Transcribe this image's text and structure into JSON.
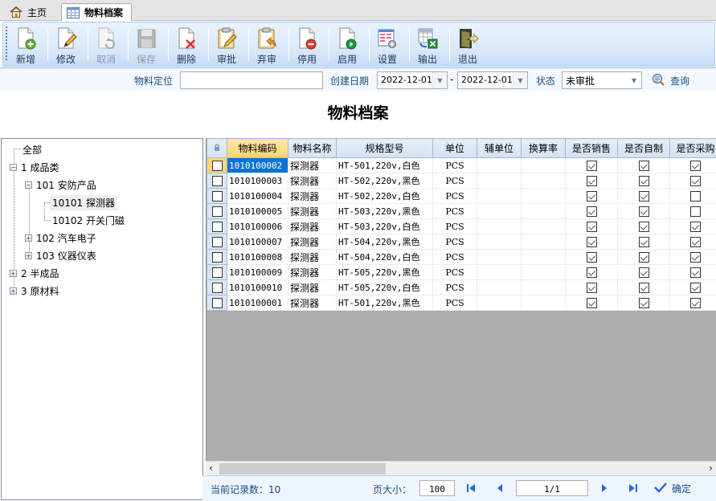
{
  "tabs": [
    {
      "label": "主页",
      "icon": "home-icon",
      "active": false
    },
    {
      "label": "物料档案",
      "icon": "table-icon",
      "active": true
    }
  ],
  "toolbar": {
    "buttons": [
      {
        "id": "add",
        "label": "新增",
        "icon": "new-document-icon",
        "enabled": true
      },
      {
        "id": "edit",
        "label": "修改",
        "icon": "edit-document-icon",
        "enabled": true
      },
      {
        "id": "cancel",
        "label": "取消",
        "icon": "undo-document-icon",
        "enabled": false
      },
      {
        "id": "save",
        "label": "保存",
        "icon": "save-floppy-icon",
        "enabled": false
      },
      {
        "id": "delete",
        "label": "删除",
        "icon": "delete-document-icon",
        "enabled": true
      },
      {
        "id": "approve",
        "label": "审批",
        "icon": "approve-clipboard-icon",
        "enabled": true
      },
      {
        "id": "unapprove",
        "label": "弃审",
        "icon": "unapprove-clipboard-icon",
        "enabled": true
      },
      {
        "id": "disable",
        "label": "停用",
        "icon": "stop-document-icon",
        "enabled": true
      },
      {
        "id": "enable",
        "label": "启用",
        "icon": "play-document-icon",
        "enabled": true
      },
      {
        "id": "settings",
        "label": "设置",
        "icon": "settings-grid-icon",
        "enabled": true
      },
      {
        "id": "export",
        "label": "输出",
        "icon": "export-excel-icon",
        "enabled": true
      },
      {
        "id": "exit",
        "label": "退出",
        "icon": "exit-door-icon",
        "enabled": true
      }
    ]
  },
  "filter": {
    "locate_label": "物料定位",
    "locate_value": "",
    "date_label": "创建日期",
    "date_from": "2022-12-01",
    "date_sep": "-",
    "date_to": "2022-12-01",
    "status_label": "状态",
    "status_value": "未审批",
    "search_label": "查询"
  },
  "page_title": "物料档案",
  "tree": [
    {
      "label": "全部",
      "level": 0,
      "expander": null
    },
    {
      "label": "1  成品类",
      "level": 0,
      "expander": "minus"
    },
    {
      "label": "101  安防产品",
      "level": 1,
      "expander": "minus"
    },
    {
      "label": "10101  探测器",
      "level": 2,
      "expander": null,
      "selected": true
    },
    {
      "label": "10102  开关门磁",
      "level": 2,
      "expander": null
    },
    {
      "label": "102  汽车电子",
      "level": 1,
      "expander": "plus"
    },
    {
      "label": "103  仪器仪表",
      "level": 1,
      "expander": "plus"
    },
    {
      "label": "2  半成品",
      "level": 0,
      "expander": "plus"
    },
    {
      "label": "3  原材料",
      "level": 0,
      "expander": "plus"
    }
  ],
  "grid": {
    "columns": [
      "物料编码",
      "物料名称",
      "规格型号",
      "单位",
      "辅单位",
      "换算率",
      "是否销售",
      "是否自制",
      "是否采购"
    ],
    "rows": [
      {
        "code": "1010100002",
        "name": "探测器",
        "spec": "HT-501,220v,白色",
        "unit": "PCS",
        "aux_unit": "",
        "rate": "",
        "sale": true,
        "self_made": true,
        "purchase": true
      },
      {
        "code": "1010100003",
        "name": "探测器",
        "spec": "HT-502,220v,黑色",
        "unit": "PCS",
        "aux_unit": "",
        "rate": "",
        "sale": true,
        "self_made": true,
        "purchase": true
      },
      {
        "code": "1010100004",
        "name": "探测器",
        "spec": "HT-502,220v,白色",
        "unit": "PCS",
        "aux_unit": "",
        "rate": "",
        "sale": true,
        "self_made": true,
        "purchase": false
      },
      {
        "code": "1010100005",
        "name": "探测器",
        "spec": "HT-503,220v,黑色",
        "unit": "PCS",
        "aux_unit": "",
        "rate": "",
        "sale": true,
        "self_made": true,
        "purchase": false
      },
      {
        "code": "1010100006",
        "name": "探测器",
        "spec": "HT-503,220v,白色",
        "unit": "PCS",
        "aux_unit": "",
        "rate": "",
        "sale": true,
        "self_made": true,
        "purchase": true
      },
      {
        "code": "1010100007",
        "name": "探测器",
        "spec": "HT-504,220v,黑色",
        "unit": "PCS",
        "aux_unit": "",
        "rate": "",
        "sale": true,
        "self_made": true,
        "purchase": true
      },
      {
        "code": "1010100008",
        "name": "探测器",
        "spec": "HT-504,220v,白色",
        "unit": "PCS",
        "aux_unit": "",
        "rate": "",
        "sale": true,
        "self_made": true,
        "purchase": true
      },
      {
        "code": "1010100009",
        "name": "探测器",
        "spec": "HT-505,220v,黑色",
        "unit": "PCS",
        "aux_unit": "",
        "rate": "",
        "sale": true,
        "self_made": true,
        "purchase": true
      },
      {
        "code": "1010100010",
        "name": "探测器",
        "spec": "HT-505,220v,白色",
        "unit": "PCS",
        "aux_unit": "",
        "rate": "",
        "sale": true,
        "self_made": true,
        "purchase": true
      },
      {
        "code": "1010100001",
        "name": "探测器",
        "spec": "HT-501,220v,黑色",
        "unit": "PCS",
        "aux_unit": "",
        "rate": "",
        "sale": true,
        "self_made": true,
        "purchase": true
      }
    ]
  },
  "pager": {
    "record_count_label": "当前记录数：10",
    "page_size_label": "页大小：",
    "page_size": "100",
    "page_indicator": "1/1",
    "confirm_label": "确定"
  },
  "colors": {
    "selected_cell": "#0a73d7",
    "sorted_header": "#fdd36f",
    "label_blue": "#1b4a8a"
  }
}
